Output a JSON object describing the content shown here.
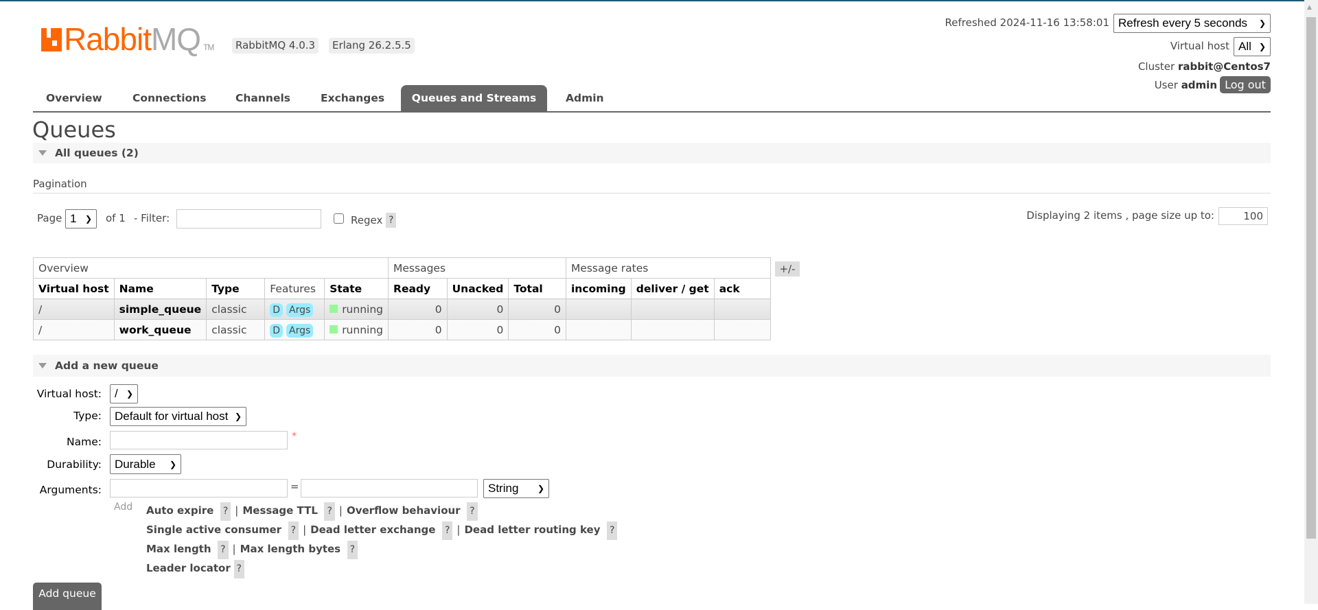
{
  "header": {
    "logo_brand": "Rabbit",
    "logo_mq": "MQ",
    "logo_tm": "TM",
    "version_badge": "RabbitMQ 4.0.3",
    "erlang_badge": "Erlang 26.2.5.5",
    "refreshed_label": "Refreshed 2024-11-16 13:58:01",
    "refresh_select": "Refresh every 5 seconds",
    "virtual_host_label": "Virtual host",
    "virtual_host_select": "All",
    "cluster_label": "Cluster",
    "cluster_name": "rabbit@Centos7",
    "user_label": "User",
    "user_name": "admin",
    "logout_label": "Log out"
  },
  "nav": {
    "tabs": [
      {
        "label": "Overview"
      },
      {
        "label": "Connections"
      },
      {
        "label": "Channels"
      },
      {
        "label": "Exchanges"
      },
      {
        "label": "Queues and Streams",
        "active": true
      },
      {
        "label": "Admin"
      }
    ]
  },
  "page": {
    "title": "Queues",
    "all_queues_label": "All queues (2)",
    "pagination_heading": "Pagination",
    "page_label": "Page",
    "page_select": "1",
    "of_label": "of 1",
    "filter_label": "- Filter:",
    "filter_value": "",
    "regex_label": "Regex",
    "help": "?",
    "displaying_label": "Displaying 2 items , page size up to:",
    "page_size": "100"
  },
  "table": {
    "groups": [
      "Overview",
      "Messages",
      "Message rates"
    ],
    "toggle_columns": "+/-",
    "columns": [
      "Virtual host",
      "Name",
      "Type",
      "Features",
      "State",
      "Ready",
      "Unacked",
      "Total",
      "incoming",
      "deliver / get",
      "ack"
    ],
    "rows": [
      {
        "vhost": "/",
        "name": "simple_queue",
        "type": "classic",
        "feature_d": "D",
        "feature_args": "Args",
        "state": "running",
        "ready": "0",
        "unacked": "0",
        "total": "0"
      },
      {
        "vhost": "/",
        "name": "work_queue",
        "type": "classic",
        "feature_d": "D",
        "feature_args": "Args",
        "state": "running",
        "ready": "0",
        "unacked": "0",
        "total": "0"
      }
    ],
    "state_color": "#98f898",
    "feature_color": "#99ebff"
  },
  "add_queue": {
    "section_label": "Add a new queue",
    "virtual_host_label": "Virtual host:",
    "virtual_host_value": "/",
    "type_label": "Type:",
    "type_value": "Default for virtual host",
    "name_label": "Name:",
    "name_value": "",
    "required_mark": "*",
    "durability_label": "Durability:",
    "durability_value": "Durable",
    "arguments_label": "Arguments:",
    "arg_equals": "=",
    "arg_type_value": "String",
    "add_label": "Add",
    "arg_shortcuts": [
      [
        "Auto expire",
        "Message TTL",
        "Overflow behaviour"
      ],
      [
        "Single active consumer",
        "Dead letter exchange",
        "Dead letter routing key"
      ],
      [
        "Max length",
        "Max length bytes"
      ],
      [
        "Leader locator"
      ]
    ],
    "submit_label": "Add queue"
  }
}
